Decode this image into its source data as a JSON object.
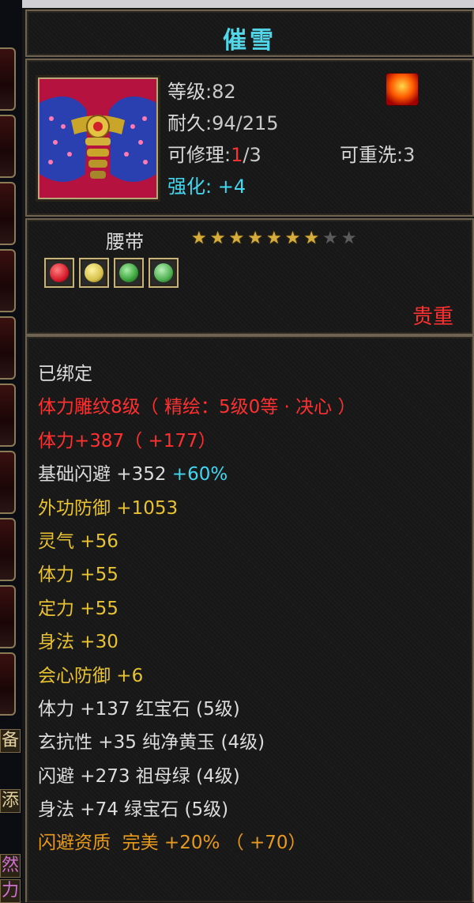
{
  "item": {
    "name": "催雪",
    "level_label": "等级",
    "level": "82",
    "durability_label": "耐久",
    "durability": "94/215",
    "repair_label": "可修理",
    "repair_used": "1",
    "repair_max": "/3",
    "reroll_label": "可重洗",
    "reroll": "3",
    "enhance_label": "强化",
    "enhance": "+4",
    "slot_type": "腰带",
    "stars_total": 9,
    "stars_filled": 7,
    "rarity": "贵重",
    "icon": "belt-item-icon",
    "buff_icon": "flame-buff-icon"
  },
  "gems": [
    {
      "icon": "red-gem-icon",
      "color": "#d81c2c"
    },
    {
      "icon": "yellow-gem-icon",
      "color": "#d6c24a"
    },
    {
      "icon": "green-gem-icon",
      "color": "#3aa23a"
    },
    {
      "icon": "emerald-gem-icon",
      "color": "#4fb04f"
    }
  ],
  "attributes": {
    "bound": "已绑定",
    "engrave": "体力雕纹8级（ 精绘：5级0等 · 决心 ）",
    "engrave_bonus": "体力+387（ +177）",
    "base_dodge": "基础闪避 +352",
    "base_dodge_pct": "+60%",
    "ext_defense": "外功防御 +1053",
    "spirit": "灵气 +56",
    "stamina": "体力 +55",
    "focus": "定力 +55",
    "agility": "身法 +30",
    "crit_def": "会心防御 +6",
    "gem1": "体力 +137 红宝石 (5级)",
    "gem2": "玄抗性 +35 纯净黄玉 (4级)",
    "gem3": "闪避 +273 祖母绿 (4级)",
    "gem4": "身法 +74 绿宝石 (5级)",
    "quality": "闪避资质  完美 +20% （ +70）"
  },
  "side": {
    "tab1": "备",
    "tab2": "添",
    "tab3": "然",
    "tab4": "力"
  },
  "colors": {
    "title": "#52d6e8",
    "red": "#ff3030",
    "yellow": "#e8c230",
    "cyan": "#40d8f0",
    "orange": "#e89a1a",
    "star_on": "#d6ad3a",
    "star_off": "#5b5b5b"
  }
}
